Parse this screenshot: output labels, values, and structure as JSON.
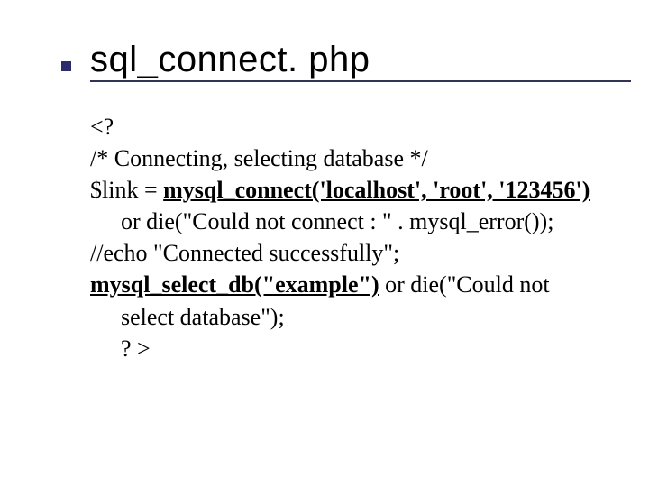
{
  "title": "sql_connect. php",
  "code": {
    "l1": "<?",
    "l2": "/* Connecting, selecting database */",
    "l3_a": "$link = ",
    "l3_b": "mysql_connect('localhost', 'root', '123456')",
    "l4": "or die(\"Could not connect : \" . mysql_error());",
    "l5": "//echo \"Connected successfully\";",
    "l6_a": "mysql_select_db(\"example\")",
    "l6_b": " or die(\"Could not ",
    "l7": "select database\");",
    "l8": "? >"
  }
}
